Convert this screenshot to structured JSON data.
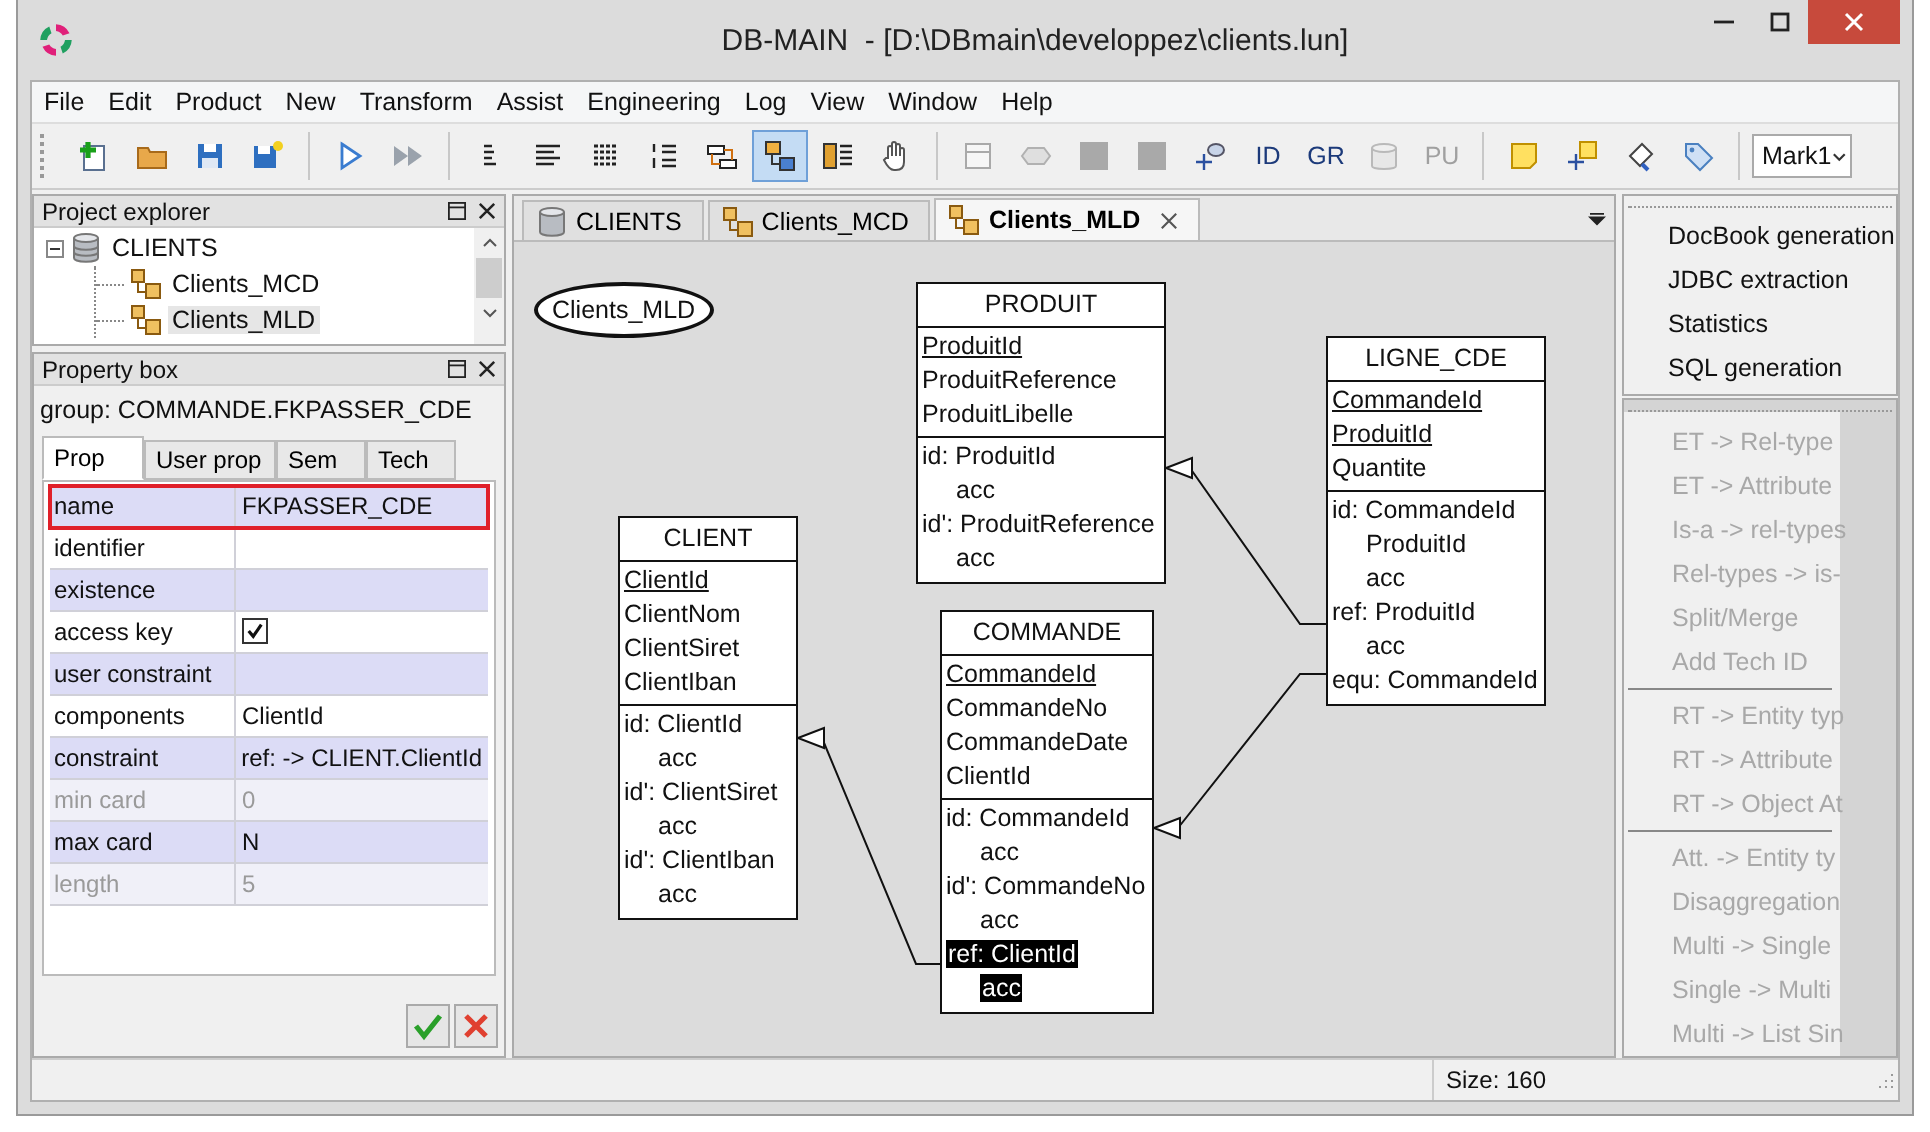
{
  "window": {
    "title": "DB-MAIN  - [D:\\DBmain\\developpez\\clients.lun]"
  },
  "menu": [
    "File",
    "Edit",
    "Product",
    "New",
    "Transform",
    "Assist",
    "Engineering",
    "Log",
    "View",
    "Window",
    "Help"
  ],
  "toolbar": [
    [
      {
        "disabled": false,
        "selected": false
      },
      {
        "disabled": false,
        "selected": false
      },
      {
        "disabled": false,
        "selected": false
      },
      {
        "disabled": false,
        "selected": false
      }
    ],
    [
      {
        "disabled": false,
        "selected": false
      },
      {
        "disabled": false,
        "selected": false
      }
    ],
    [
      {
        "disabled": false,
        "selected": false
      },
      {
        "disabled": false,
        "selected": false
      },
      {
        "disabled": false,
        "selected": false
      },
      {
        "disabled": false,
        "selected": false
      },
      {
        "disabled": false,
        "selected": false
      },
      {
        "disabled": false,
        "selected": true
      },
      {
        "disabled": false,
        "selected": false
      },
      {
        "disabled": false,
        "selected": false
      }
    ],
    [
      {
        "disabled": true,
        "selected": false
      },
      {
        "disabled": true,
        "selected": false
      },
      {
        "disabled": true,
        "selected": false
      },
      {
        "disabled": true,
        "selected": false
      },
      {
        "disabled": false,
        "selected": false
      },
      {
        "label": "ID",
        "disabled": false,
        "selected": false
      },
      {
        "label": "GR",
        "disabled": false,
        "selected": false
      },
      {
        "disabled": true,
        "selected": false
      },
      {
        "label": "PU",
        "disabled": true,
        "selected": false
      }
    ],
    [
      {
        "disabled": false,
        "selected": false
      },
      {
        "disabled": false,
        "selected": false
      },
      {
        "disabled": false,
        "selected": false
      },
      {
        "disabled": false,
        "selected": false
      }
    ]
  ],
  "mark_selector": {
    "value": "Mark1"
  },
  "project_explorer": {
    "title": "Project explorer",
    "tree": [
      {
        "label": "CLIENTS",
        "expanded": true,
        "selected": false,
        "children": [
          {
            "label": "Clients_MCD",
            "selected": false
          },
          {
            "label": "Clients_MLD",
            "selected": true
          }
        ]
      }
    ]
  },
  "property_box": {
    "title": "Property box",
    "subject": "group: COMMANDE.FKPASSER_CDE",
    "tabs": [
      {
        "label": "Prop",
        "selected": true
      },
      {
        "label": "User prop",
        "selected": false
      },
      {
        "label": "Sem",
        "selected": false
      },
      {
        "label": "Tech",
        "selected": false
      }
    ],
    "rows": [
      {
        "kind": "text",
        "label": "name",
        "value": "FKPASSER_CDE",
        "disabled": false,
        "selected": true
      },
      {
        "kind": "text",
        "label": "identifier",
        "disabled": false,
        "selected": false
      },
      {
        "kind": "text",
        "label": "existence",
        "disabled": false,
        "selected": false
      },
      {
        "kind": "checkbox",
        "label": "access key",
        "checked": true,
        "disabled": false,
        "selected": false
      },
      {
        "kind": "text",
        "label": "user constraint",
        "disabled": false,
        "selected": false
      },
      {
        "kind": "text",
        "label": "components",
        "value": "ClientId",
        "disabled": false,
        "selected": false
      },
      {
        "kind": "text",
        "label": "constraint",
        "value": "ref:  -> CLIENT.ClientId",
        "disabled": false,
        "selected": false
      },
      {
        "kind": "text",
        "label": "min card",
        "value": "0",
        "disabled": true,
        "selected": false
      },
      {
        "kind": "text",
        "label": "max card",
        "value": "N",
        "disabled": false,
        "selected": false
      },
      {
        "kind": "text",
        "label": "length",
        "value": "5",
        "disabled": true,
        "selected": false
      }
    ]
  },
  "doc_tabs": [
    {
      "label": "CLIENTS",
      "selected": false
    },
    {
      "label": "Clients_MCD",
      "selected": false
    },
    {
      "label": "Clients_MLD",
      "selected": true
    }
  ],
  "diagram": {
    "schema_label": "Clients_MLD",
    "entities": [
      {
        "name": "PRODUIT",
        "attributes": [
          {
            "name": "ProduitId",
            "identifier": true
          },
          {
            "name": "ProduitReference",
            "identifier": false
          },
          {
            "name": "ProduitLibelle",
            "identifier": false
          }
        ],
        "groups": [
          {
            "text": "id: ProduitId",
            "kind": "key",
            "selected": false
          },
          {
            "text": "acc",
            "kind": "sub",
            "selected": false
          },
          {
            "text": "id': ProduitReference",
            "kind": "key",
            "selected": false
          },
          {
            "text": "acc",
            "kind": "sub",
            "selected": false
          }
        ]
      },
      {
        "name": "LIGNE_CDE",
        "attributes": [
          {
            "name": "CommandeId",
            "identifier": true
          },
          {
            "name": "ProduitId",
            "identifier": true
          },
          {
            "name": "Quantite",
            "identifier": false
          }
        ],
        "groups": [
          {
            "text": "id: CommandeId",
            "kind": "key",
            "selected": false
          },
          {
            "text": "ProduitId",
            "kind": "sub",
            "selected": false
          },
          {
            "text": "acc",
            "kind": "sub",
            "selected": false
          },
          {
            "text": "ref: ProduitId",
            "kind": "key",
            "selected": false
          },
          {
            "text": "acc",
            "kind": "sub",
            "selected": false
          },
          {
            "text": "equ: CommandeId",
            "kind": "key",
            "selected": false
          }
        ]
      },
      {
        "name": "CLIENT",
        "attributes": [
          {
            "name": "ClientId",
            "identifier": true
          },
          {
            "name": "ClientNom",
            "identifier": false
          },
          {
            "name": "ClientSiret",
            "identifier": false
          },
          {
            "name": "ClientIban",
            "identifier": false
          }
        ],
        "groups": [
          {
            "text": "id: ClientId",
            "kind": "key",
            "selected": false
          },
          {
            "text": "acc",
            "kind": "sub",
            "selected": false
          },
          {
            "text": "id': ClientSiret",
            "kind": "key",
            "selected": false
          },
          {
            "text": "acc",
            "kind": "sub",
            "selected": false
          },
          {
            "text": "id': ClientIban",
            "kind": "key",
            "selected": false
          },
          {
            "text": "acc",
            "kind": "sub",
            "selected": false
          }
        ]
      },
      {
        "name": "COMMANDE",
        "attributes": [
          {
            "name": "CommandeId",
            "identifier": true
          },
          {
            "name": "CommandeNo",
            "identifier": false
          },
          {
            "name": "CommandeDate",
            "identifier": false
          },
          {
            "name": "ClientId",
            "identifier": false
          }
        ],
        "groups": [
          {
            "text": "id: CommandeId",
            "kind": "key",
            "selected": false
          },
          {
            "text": "acc",
            "kind": "sub",
            "selected": false
          },
          {
            "text": "id': CommandeNo",
            "kind": "key",
            "selected": false
          },
          {
            "text": "acc",
            "kind": "sub",
            "selected": false
          },
          {
            "text": "ref: ClientId",
            "kind": "key",
            "selected": true
          },
          {
            "text": "acc",
            "kind": "sub",
            "selected": true
          }
        ]
      }
    ]
  },
  "toolboxes": [
    {
      "groups": [
        [
          {
            "label": "DocBook generation",
            "disabled": false
          },
          {
            "label": "JDBC extraction",
            "disabled": false
          },
          {
            "label": "Statistics",
            "disabled": false
          },
          {
            "label": "SQL generation",
            "disabled": false
          }
        ]
      ]
    },
    {
      "groups": [
        [
          {
            "label": "ET -> Rel-type",
            "disabled": true
          },
          {
            "label": "ET -> Attribute",
            "disabled": true
          },
          {
            "label": "Is-a -> rel-types",
            "disabled": true
          },
          {
            "label": "Rel-types -> is-",
            "disabled": true
          },
          {
            "label": "Split/Merge",
            "disabled": true
          },
          {
            "label": "Add Tech ID",
            "disabled": true
          }
        ],
        [
          {
            "label": "RT -> Entity typ",
            "disabled": true
          },
          {
            "label": "RT -> Attribute",
            "disabled": true
          },
          {
            "label": "RT -> Object At",
            "disabled": true
          }
        ],
        [
          {
            "label": "Att. -> Entity ty",
            "disabled": true
          },
          {
            "label": "Disaggregation",
            "disabled": true
          },
          {
            "label": "Multi -> Single",
            "disabled": true
          },
          {
            "label": "Single -> Multi",
            "disabled": true
          },
          {
            "label": "Multi -> List Sin",
            "disabled": true
          }
        ]
      ]
    }
  ],
  "status_bar": {
    "size": "Size: 160"
  }
}
